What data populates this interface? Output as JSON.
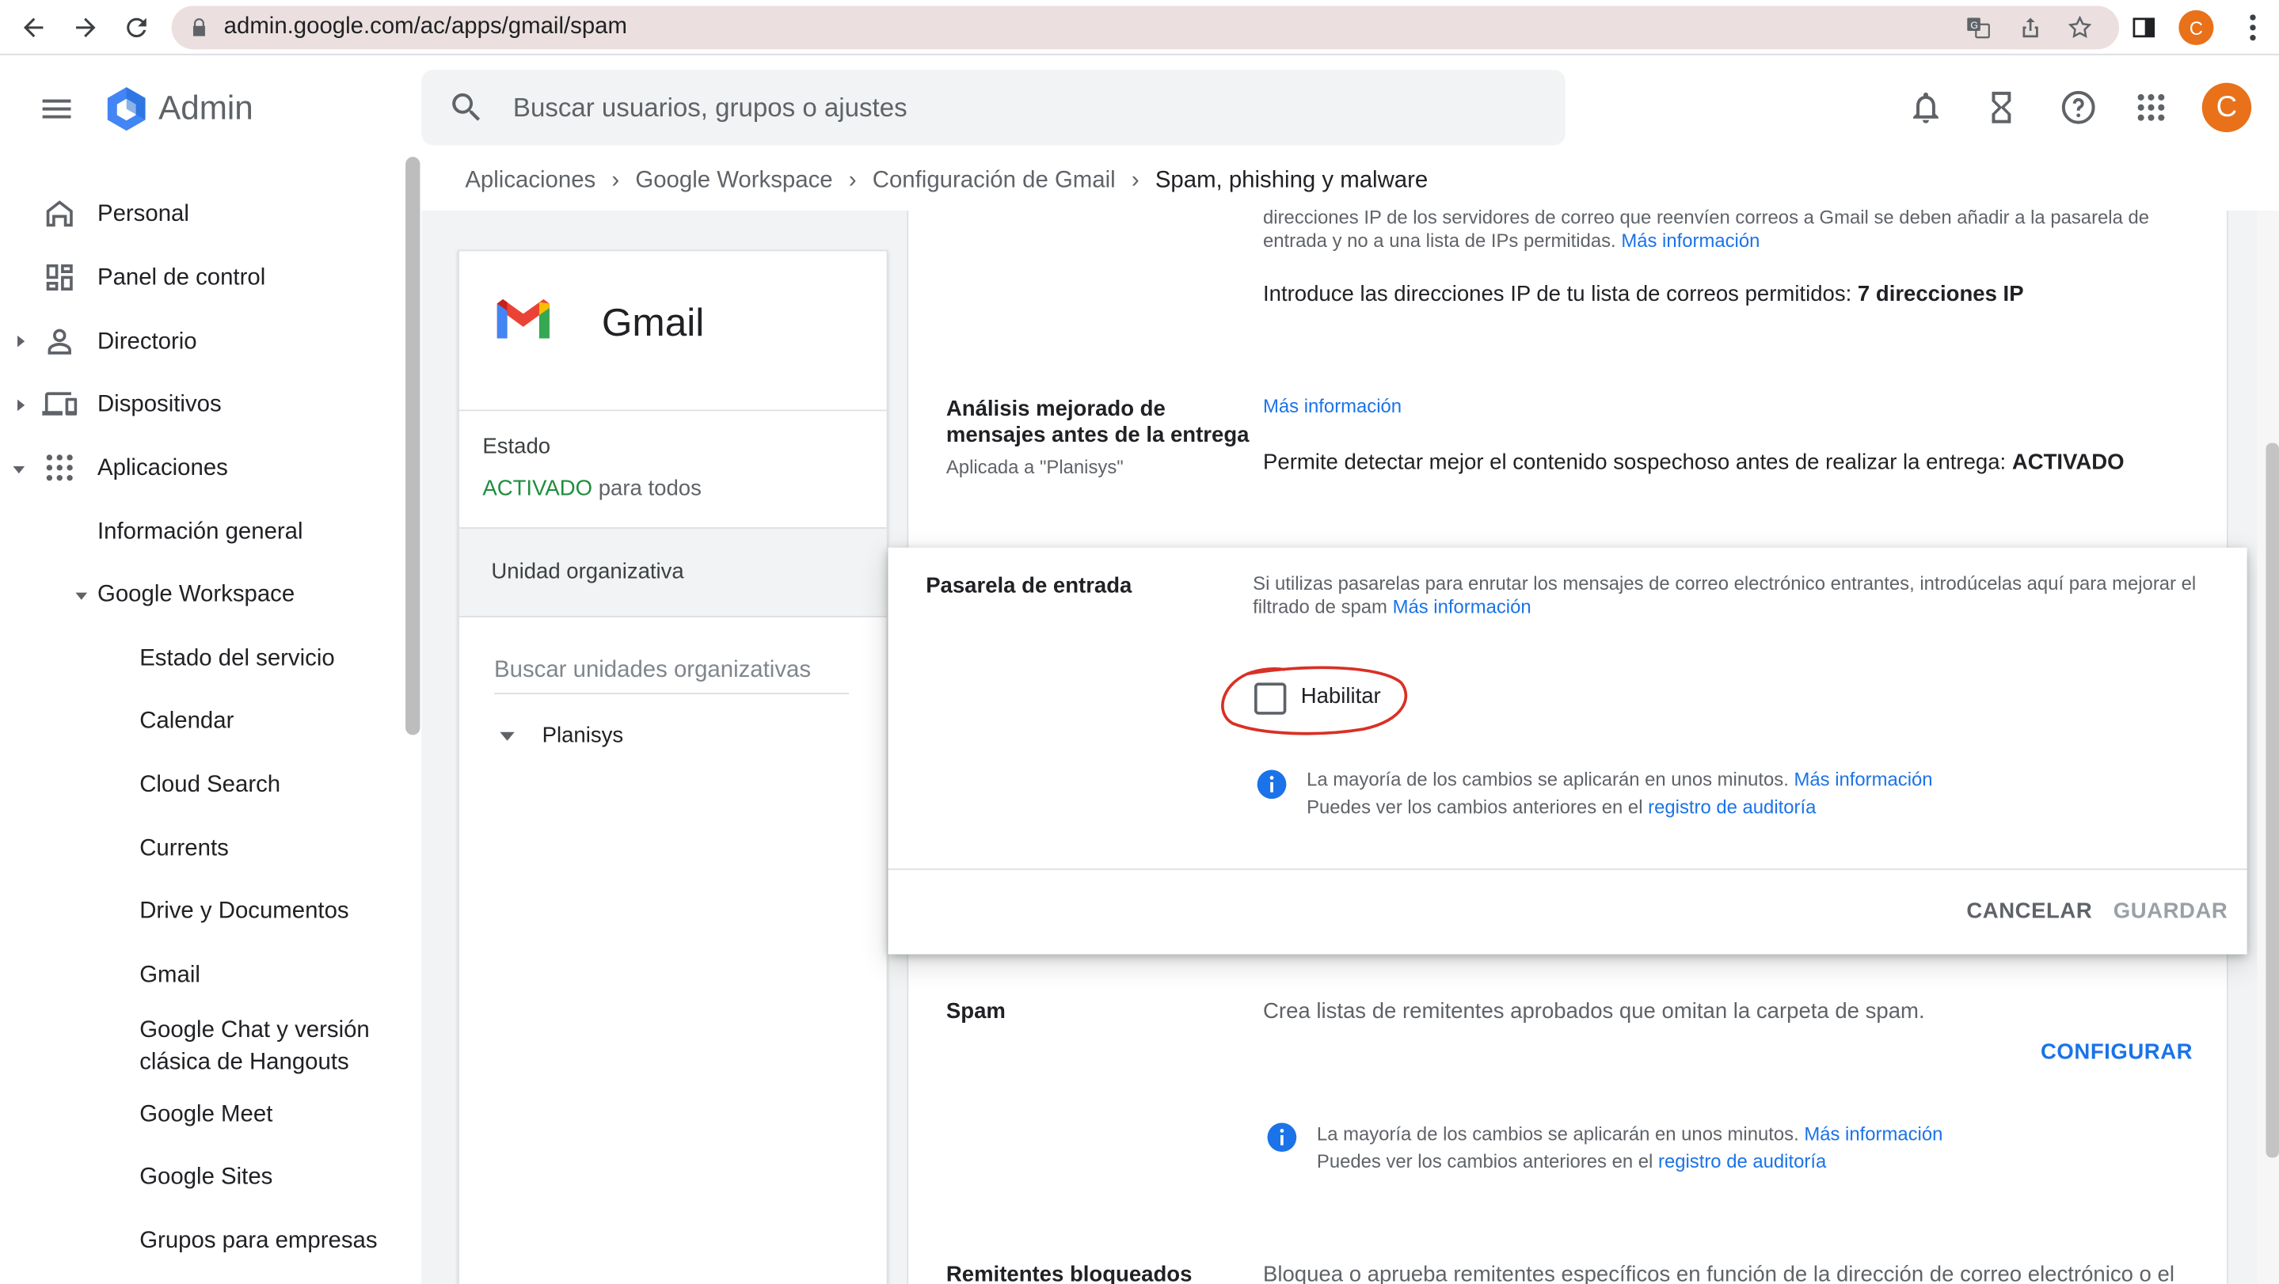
{
  "browser": {
    "url": "admin.google.com/ac/apps/gmail/spam",
    "profile_initial": "C"
  },
  "header": {
    "app_name": "Admin",
    "search_placeholder": "Buscar usuarios, grupos o ajustes",
    "avatar_initial": "C"
  },
  "sidebar": {
    "items": [
      {
        "label": "Personal"
      },
      {
        "label": "Panel de control"
      },
      {
        "label": "Directorio"
      },
      {
        "label": "Dispositivos"
      },
      {
        "label": "Aplicaciones"
      },
      {
        "label": "Información general"
      },
      {
        "label": "Google Workspace"
      },
      {
        "label": "Estado del servicio"
      },
      {
        "label": "Calendar"
      },
      {
        "label": "Cloud Search"
      },
      {
        "label": "Currents"
      },
      {
        "label": "Drive y Documentos"
      },
      {
        "label": "Gmail"
      },
      {
        "label": "Google Chat y versión clásica de Hangouts"
      },
      {
        "label": "Google Meet"
      },
      {
        "label": "Google Sites"
      },
      {
        "label": "Grupos para empresas"
      }
    ]
  },
  "breadcrumb": {
    "items": [
      "Aplicaciones",
      "Google Workspace",
      "Configuración de Gmail",
      "Spam, phishing y malware"
    ]
  },
  "gmail_card": {
    "title": "Gmail",
    "status_label": "Estado",
    "status_value": "ACTIVADO",
    "status_suffix": " para todos",
    "org_unit_label": "Unidad organizativa",
    "org_search_placeholder": "Buscar unidades organizativas",
    "org_root": "Planisys"
  },
  "main": {
    "top_desc_line1": "direcciones IP de los servidores de correo que reenvíen correos a Gmail se deben añadir a la pasarela de",
    "top_desc_line2": "entrada y no a una lista de IPs permitidas.",
    "top_more_info": "Más información",
    "ip_list_text": "Introduce las direcciones IP de tu lista de correos permitidos: ",
    "ip_list_value": "7 direcciones IP",
    "analysis_label": "Análisis mejorado de mensajes antes de la entrega",
    "analysis_applied": "Aplicada a \"Planisys\"",
    "analysis_more_info": "Más información",
    "analysis_text": "Permite detectar mejor el contenido sospechoso antes de realizar la entrega: ",
    "analysis_value": "ACTIVADO",
    "spam_label": "Spam",
    "spam_desc": "Crea listas de remitentes aprobados que omitan la carpeta de spam.",
    "spam_configure": "CONFIGURAR",
    "spam_info_line1": "La mayoría de los cambios se aplicarán en unos minutos. ",
    "spam_info_link1": "Más información",
    "spam_info_line2": "Puedes ver los cambios anteriores en el ",
    "spam_info_link2": "registro de auditoría",
    "blocked_label": "Remitentes bloqueados",
    "blocked_desc": "Bloquea o aprueba remitentes específicos en función de la dirección de correo electrónico o el"
  },
  "dialog": {
    "title": "Pasarela de entrada",
    "desc": "Si utilizas pasarelas para enrutar los mensajes de correo electrónico entrantes, introdúcelas aquí para mejorar el filtrado de spam ",
    "desc_link": "Más información",
    "checkbox_label": "Habilitar",
    "checkbox_checked": false,
    "info_line1": "La mayoría de los cambios se aplicarán en unos minutos. ",
    "info_link1": "Más información",
    "info_line2": "Puedes ver los cambios anteriores en el ",
    "info_link2": "registro de auditoría",
    "cancel": "CANCELAR",
    "save": "GUARDAR"
  },
  "colors": {
    "accent": "#1a73e8",
    "status_green": "#1e8e3e",
    "avatar": "#e8711a",
    "annotation": "#d93025"
  }
}
